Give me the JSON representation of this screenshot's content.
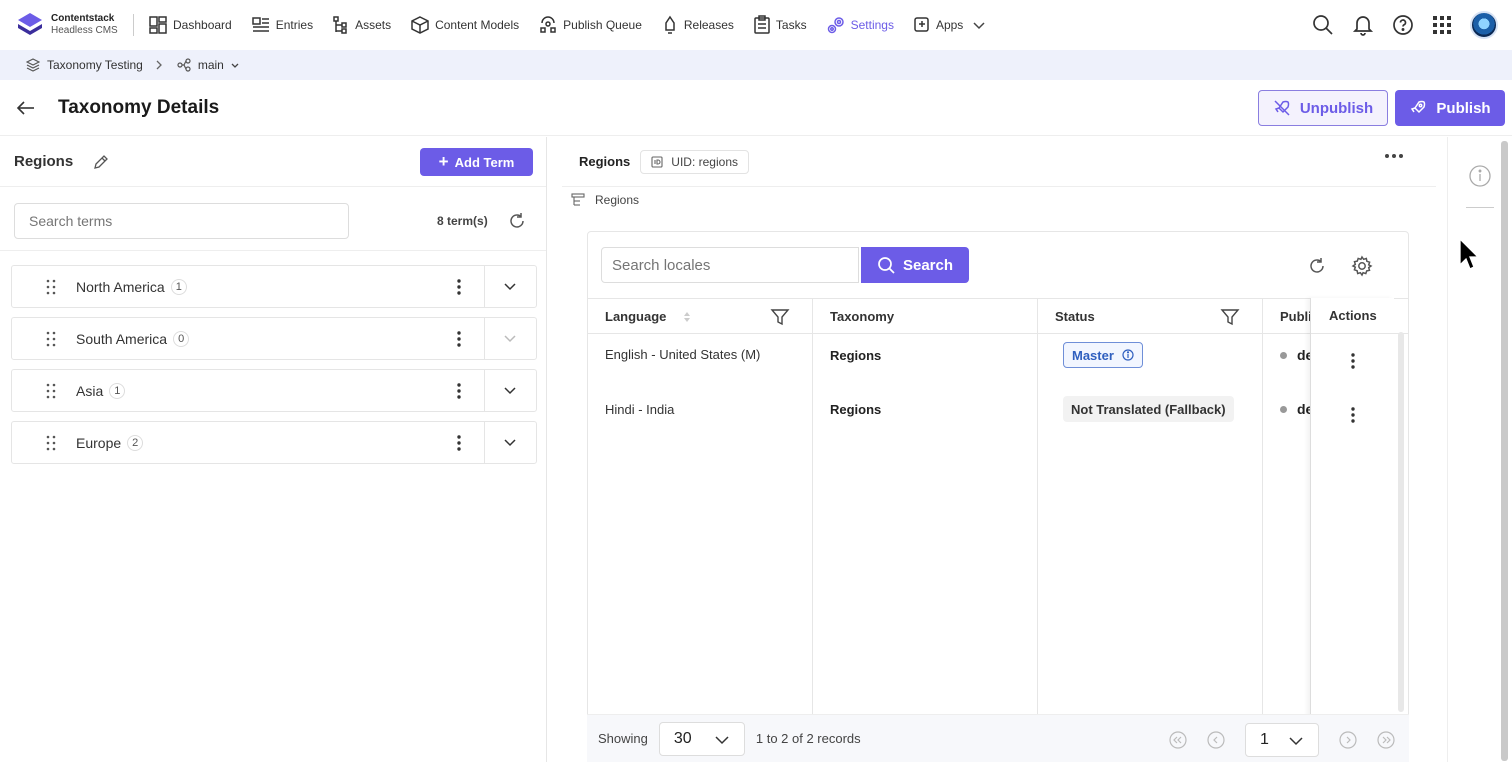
{
  "brand": {
    "name": "Contentstack",
    "subtitle": "Headless CMS"
  },
  "nav": {
    "items": [
      {
        "label": "Dashboard",
        "icon": "dashboard-icon"
      },
      {
        "label": "Entries",
        "icon": "entries-icon"
      },
      {
        "label": "Assets",
        "icon": "assets-icon"
      },
      {
        "label": "Content Models",
        "icon": "cube-icon"
      },
      {
        "label": "Publish Queue",
        "icon": "publish-queue-icon"
      },
      {
        "label": "Releases",
        "icon": "rocket-icon"
      },
      {
        "label": "Tasks",
        "icon": "clipboard-icon"
      },
      {
        "label": "Settings",
        "icon": "gears-icon",
        "active": true
      },
      {
        "label": "Apps",
        "icon": "apps-icon"
      }
    ],
    "right_icons": [
      "search-icon",
      "bell-icon",
      "help-icon",
      "grid-icon",
      "avatar"
    ]
  },
  "breadcrumb": {
    "stack": "Taxonomy Testing",
    "branch": "main"
  },
  "page": {
    "title": "Taxonomy Details",
    "unpublish_label": "Unpublish",
    "publish_label": "Publish"
  },
  "left": {
    "title": "Regions",
    "add_term_label": "Add Term",
    "search_placeholder": "Search terms",
    "term_count": "8 term(s)",
    "terms": [
      {
        "name": "North America",
        "count": "1"
      },
      {
        "name": "South America",
        "count": "0"
      },
      {
        "name": "Asia",
        "count": "1"
      },
      {
        "name": "Europe",
        "count": "2"
      }
    ]
  },
  "right": {
    "title": "Regions",
    "uid": "UID: regions",
    "crumb": "Regions",
    "search_placeholder": "Search locales",
    "search_label": "Search",
    "columns": {
      "language": "Language",
      "taxonomy": "Taxonomy",
      "status": "Status",
      "published": "Publi",
      "actions": "Actions"
    },
    "rows": [
      {
        "language": "English - United States",
        "master_mark": "(M)",
        "taxonomy": "Regions",
        "status": "Master",
        "published": "de"
      },
      {
        "language": "Hindi - India",
        "master_mark": "",
        "taxonomy": "Regions",
        "status": "Not Translated (Fallback)",
        "published": "de"
      }
    ],
    "footer": {
      "showing_label": "Showing",
      "page_size": "30",
      "records": "1 to 2 of 2 records",
      "page": "1"
    }
  },
  "colors": {
    "accent": "#6c5ce7",
    "master_blue": "#2f5fbf",
    "breadcrumb_bg": "#eef1fb"
  }
}
